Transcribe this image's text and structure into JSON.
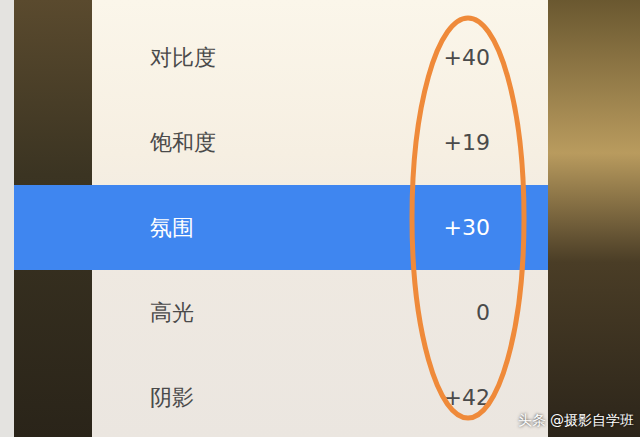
{
  "adjustments": [
    {
      "label": "对比度",
      "value": "+40",
      "selected": false
    },
    {
      "label": "饱和度",
      "value": "+19",
      "selected": false
    },
    {
      "label": "氛围",
      "value": "+30",
      "selected": true
    },
    {
      "label": "高光",
      "value": "0",
      "selected": false
    },
    {
      "label": "阴影",
      "value": "+42",
      "selected": false
    }
  ],
  "watermark": "头条 @摄影自学班"
}
